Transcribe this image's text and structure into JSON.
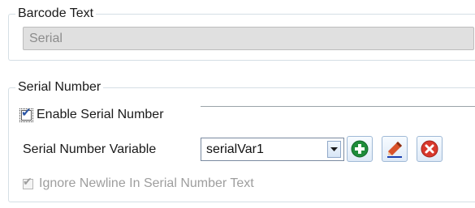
{
  "barcode_text": {
    "legend": "Barcode Text",
    "value": "Serial"
  },
  "serial_number": {
    "legend": "Serial Number",
    "enable_checkbox": {
      "label": "Enable Serial Number",
      "checked": true
    },
    "variable": {
      "label": "Serial Number Variable",
      "selected": "serialVar1"
    },
    "buttons": {
      "add_icon": "plus-circle-icon",
      "edit_icon": "pencil-icon",
      "delete_icon": "x-circle-icon"
    },
    "ignore_newline_checkbox": {
      "label": "Ignore Newline In Serial Number Text",
      "checked": true,
      "enabled": false
    }
  },
  "colors": {
    "add": "#1e8c3a",
    "delete": "#d8382c",
    "pencil": "#d9532b",
    "group_border": "#d5dfe5"
  }
}
